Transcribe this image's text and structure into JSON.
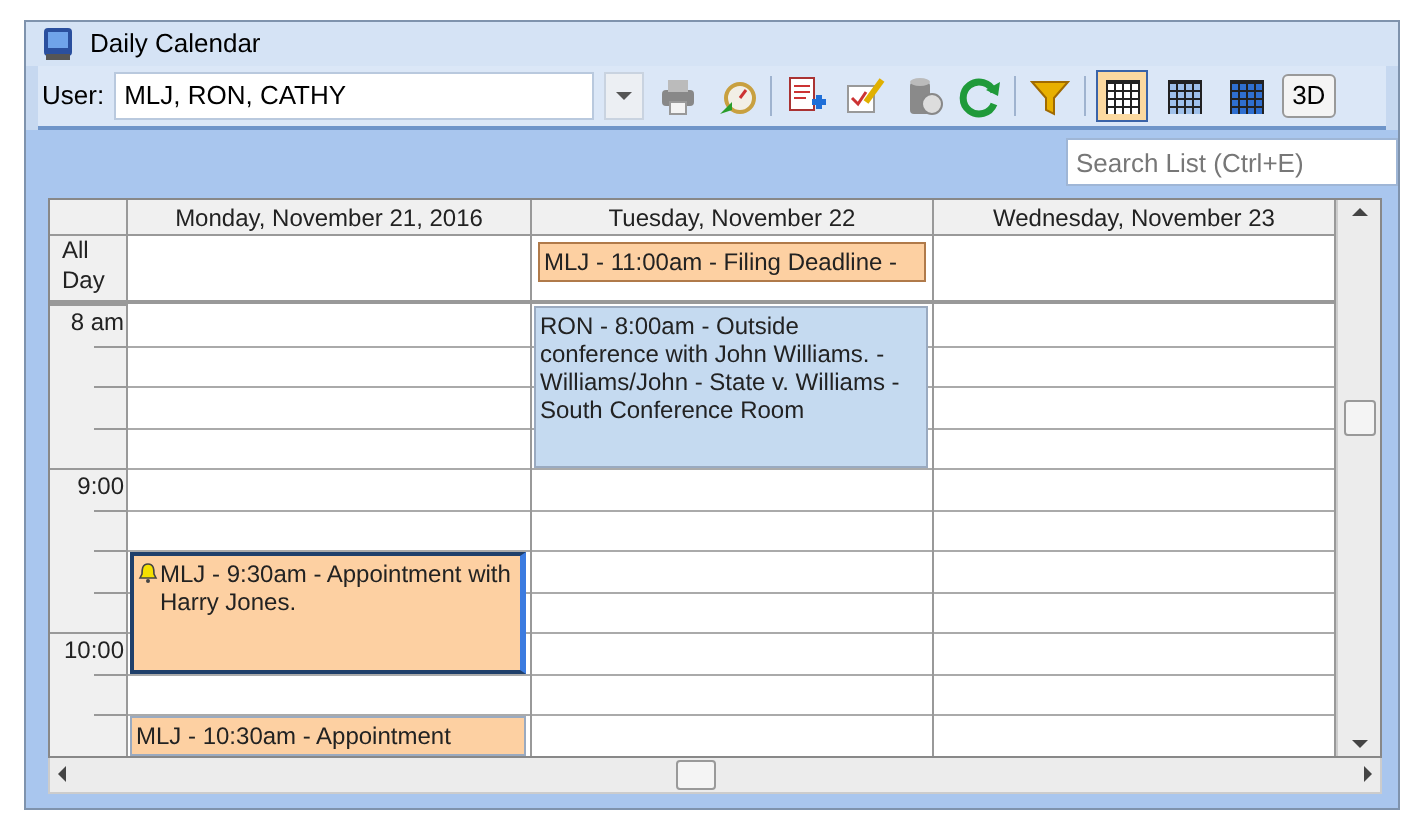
{
  "window": {
    "title": "Daily Calendar"
  },
  "toolbar": {
    "user_label": "User:",
    "user_value": "MLJ, RON, CATHY",
    "views": [
      {
        "selected": true
      },
      {
        "selected": false
      },
      {
        "selected": false
      }
    ],
    "three_d_label": "3D"
  },
  "search": {
    "placeholder": "Search List (Ctrl+E)"
  },
  "all_day_label": "All Day",
  "days": [
    {
      "header": "Monday, November 21, 2016",
      "slots": [
        {
          "kind": "free"
        },
        {
          "kind": "free"
        },
        {
          "kind": "free"
        },
        {
          "kind": "free"
        },
        {
          "kind": "free"
        },
        {
          "kind": "free"
        },
        {
          "kind": "event",
          "text": "MLJ - 9:30am - Appointment with Harry Jones.",
          "color": "#fdd0a2",
          "alert": true,
          "selected": true
        },
        {
          "kind": "more"
        },
        {
          "kind": "more"
        },
        {
          "kind": "free"
        },
        {
          "kind": "event",
          "text": "MLJ - 10:30am - Appointment",
          "color": "#fdd0a2",
          "alert": false,
          "selected": false
        }
      ]
    },
    {
      "header": "Tuesday, November 22",
      "all_day": [
        {
          "text": "MLJ - 11:00am - Filing Deadline -",
          "color": "#fdd0a2"
        }
      ],
      "slots": [
        {
          "kind": "event",
          "text": "RON - 8:00am - Outside conference with John Williams. - Williams/John - State v. Williams - South Conference Room",
          "color": "#c5daf0",
          "alert": false,
          "selected": false
        },
        {
          "kind": "more"
        },
        {
          "kind": "more"
        },
        {
          "kind": "more"
        },
        {
          "kind": "free"
        },
        {
          "kind": "free"
        },
        {
          "kind": "free"
        },
        {
          "kind": "free"
        },
        {
          "kind": "free"
        },
        {
          "kind": "free"
        },
        {
          "kind": "free"
        }
      ]
    },
    {
      "header": "Wednesday, November 23",
      "slots": [
        {
          "kind": "free"
        },
        {
          "kind": "free"
        },
        {
          "kind": "free"
        },
        {
          "kind": "free"
        },
        {
          "kind": "free"
        },
        {
          "kind": "free"
        },
        {
          "kind": "free"
        },
        {
          "kind": "free"
        },
        {
          "kind": "free"
        },
        {
          "kind": "free"
        },
        {
          "kind": "free"
        }
      ]
    }
  ],
  "rows": [
    {
      "label": "8 am"
    },
    {},
    {},
    {},
    {
      "label": "9:00"
    },
    {},
    {},
    {},
    {
      "label": "10:00"
    },
    {},
    {}
  ]
}
